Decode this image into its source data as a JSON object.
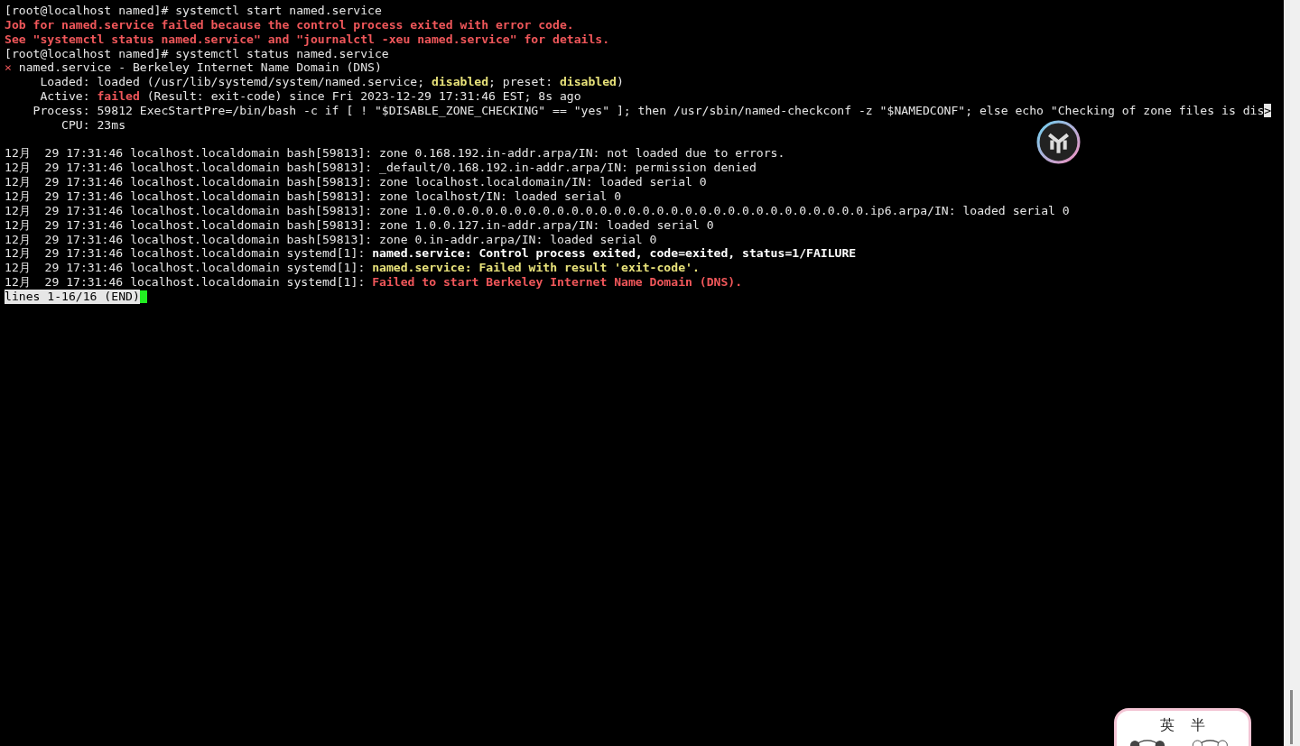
{
  "terminal": {
    "lines": [
      {
        "kind": "text",
        "segments": [
          {
            "kind": "plain",
            "text": "[root@localhost named]# systemctl start named.service"
          }
        ]
      },
      {
        "kind": "text",
        "segments": [
          {
            "kind": "error",
            "text": "Job for named.service failed because the control process exited with error code."
          }
        ]
      },
      {
        "kind": "text",
        "segments": [
          {
            "kind": "error",
            "text": "See \"systemctl status named.service\" and \"journalctl -xeu named.service\" for details."
          }
        ]
      },
      {
        "kind": "text",
        "segments": [
          {
            "kind": "plain",
            "text": "[root@localhost named]# systemctl status named.service"
          }
        ]
      },
      {
        "kind": "text",
        "segments": [
          {
            "kind": "cross",
            "text": "×"
          },
          {
            "kind": "plain",
            "text": " named.service - Berkeley Internet Name Domain (DNS)"
          }
        ]
      },
      {
        "kind": "text",
        "segments": [
          {
            "kind": "plain",
            "text": "     Loaded: loaded (/usr/lib/systemd/system/named.service; "
          },
          {
            "kind": "warning",
            "text": "disabled"
          },
          {
            "kind": "plain",
            "text": "; preset: "
          },
          {
            "kind": "warning",
            "text": "disabled"
          },
          {
            "kind": "plain",
            "text": ")"
          }
        ]
      },
      {
        "kind": "text",
        "segments": [
          {
            "kind": "plain",
            "text": "     Active: "
          },
          {
            "kind": "error",
            "text": "failed"
          },
          {
            "kind": "plain",
            "text": " (Result: exit-code) since Fri 2023-12-29 17:31:46 EST; 8s ago"
          }
        ]
      },
      {
        "kind": "text",
        "segments": [
          {
            "kind": "plain",
            "text": "    Process: 59812 ExecStartPre=/bin/bash -c if [ ! \"$DISABLE_ZONE_CHECKING\" == \"yes\" ]; then /usr/sbin/named-checkconf -z \"$NAMEDCONF\"; else echo \"Checking of zone files is dis"
          },
          {
            "kind": "marker",
            "text": ">"
          }
        ]
      },
      {
        "kind": "text",
        "segments": [
          {
            "kind": "plain",
            "text": "        CPU: 23ms"
          }
        ]
      },
      {
        "kind": "blank"
      },
      {
        "kind": "text",
        "segments": [
          {
            "kind": "plain",
            "text": "12月  29 17:31:46 localhost.localdomain bash[59813]: zone 0.168.192.in-addr.arpa/IN: not loaded due to errors."
          }
        ]
      },
      {
        "kind": "text",
        "segments": [
          {
            "kind": "plain",
            "text": "12月  29 17:31:46 localhost.localdomain bash[59813]: _default/0.168.192.in-addr.arpa/IN: permission denied"
          }
        ]
      },
      {
        "kind": "text",
        "segments": [
          {
            "kind": "plain",
            "text": "12月  29 17:31:46 localhost.localdomain bash[59813]: zone localhost.localdomain/IN: loaded serial 0"
          }
        ]
      },
      {
        "kind": "text",
        "segments": [
          {
            "kind": "plain",
            "text": "12月  29 17:31:46 localhost.localdomain bash[59813]: zone localhost/IN: loaded serial 0"
          }
        ]
      },
      {
        "kind": "text",
        "segments": [
          {
            "kind": "plain",
            "text": "12月  29 17:31:46 localhost.localdomain bash[59813]: zone 1.0.0.0.0.0.0.0.0.0.0.0.0.0.0.0.0.0.0.0.0.0.0.0.0.0.0.0.0.0.0.0.ip6.arpa/IN: loaded serial 0"
          }
        ]
      },
      {
        "kind": "text",
        "segments": [
          {
            "kind": "plain",
            "text": "12月  29 17:31:46 localhost.localdomain bash[59813]: zone 1.0.0.127.in-addr.arpa/IN: loaded serial 0"
          }
        ]
      },
      {
        "kind": "text",
        "segments": [
          {
            "kind": "plain",
            "text": "12月  29 17:31:46 localhost.localdomain bash[59813]: zone 0.in-addr.arpa/IN: loaded serial 0"
          }
        ]
      },
      {
        "kind": "text",
        "segments": [
          {
            "kind": "plain",
            "text": "12月  29 17:31:46 localhost.localdomain systemd[1]: "
          },
          {
            "kind": "highlight",
            "text": "named.service: Control process exited, code=exited, status=1/FAILURE"
          }
        ]
      },
      {
        "kind": "text",
        "segments": [
          {
            "kind": "plain",
            "text": "12月  29 17:31:46 localhost.localdomain systemd[1]: "
          },
          {
            "kind": "warning",
            "text": "named.service: Failed with result 'exit-code'."
          }
        ]
      },
      {
        "kind": "text",
        "segments": [
          {
            "kind": "plain",
            "text": "12月  29 17:31:46 localhost.localdomain systemd[1]: "
          },
          {
            "kind": "error",
            "text": "Failed to start Berkeley Internet Name Domain (DNS)."
          }
        ]
      }
    ],
    "pager_status": "lines 1-16/16 (END)"
  },
  "ime_toolbar": {
    "language": "英",
    "width_mode": "半"
  }
}
